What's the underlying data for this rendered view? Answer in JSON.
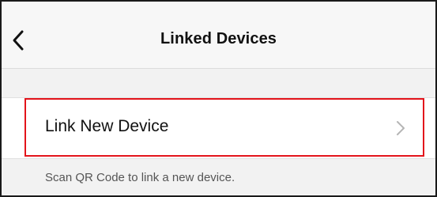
{
  "nav": {
    "title": "Linked Devices",
    "back_icon": "chevron-left-icon"
  },
  "list": {
    "link_new_device": {
      "label": "Link New Device",
      "icon": "chevron-right-icon",
      "highlighted": true
    }
  },
  "footer": {
    "hint": "Scan QR Code to link a new device."
  },
  "colors": {
    "highlight": "#e3141b",
    "background": "#f2f2f2",
    "cell": "#ffffff"
  }
}
